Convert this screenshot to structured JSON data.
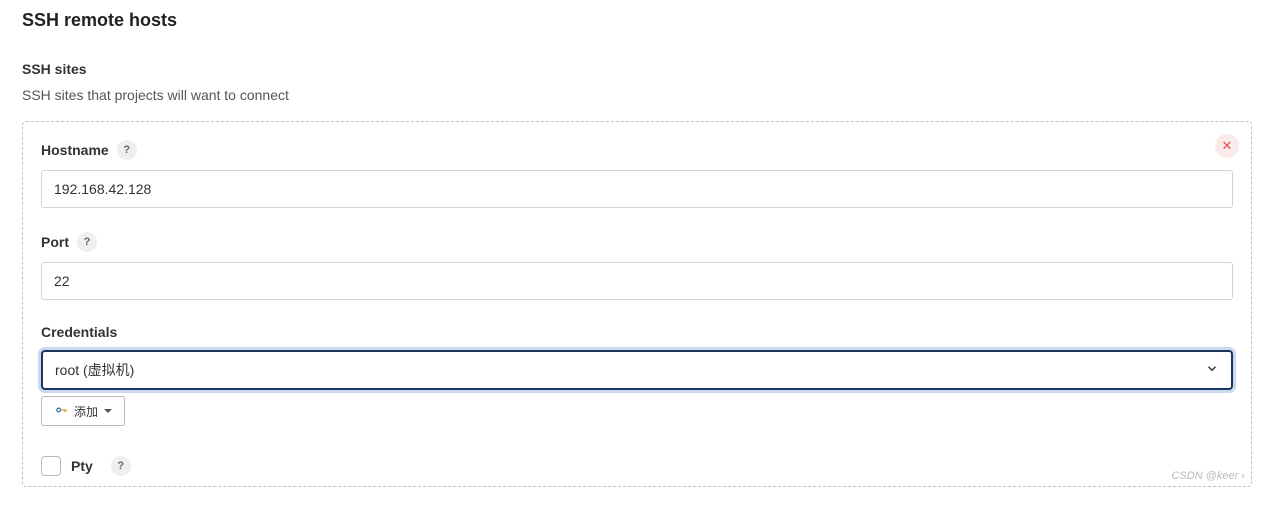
{
  "page": {
    "title": "SSH remote hosts",
    "section_label": "SSH sites",
    "section_desc": "SSH sites that projects will want to connect"
  },
  "form": {
    "hostname": {
      "label": "Hostname",
      "value": "192.168.42.128"
    },
    "port": {
      "label": "Port",
      "value": "22"
    },
    "credentials": {
      "label": "Credentials",
      "value": "root (虚拟机)",
      "add_button_label": "添加"
    },
    "pty": {
      "label": "Pty",
      "checked": false
    }
  },
  "icons": {
    "help": "?",
    "close": "✕"
  },
  "watermark": "CSDN @keer"
}
